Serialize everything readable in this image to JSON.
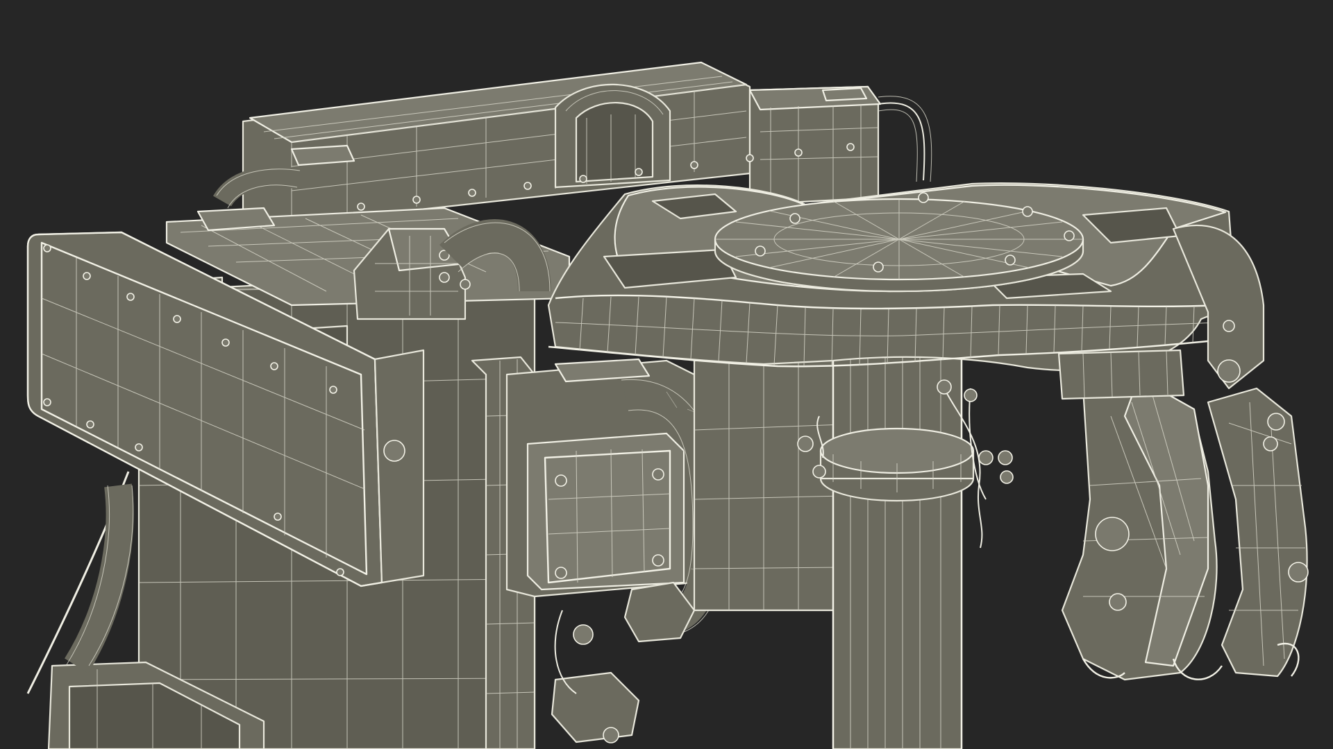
{
  "scene": {
    "background_color": "#262626",
    "model_fill_color": "#6b6a5e",
    "wireframe_color": "#e9e8dc",
    "subject": "wireframe-3d-model"
  }
}
